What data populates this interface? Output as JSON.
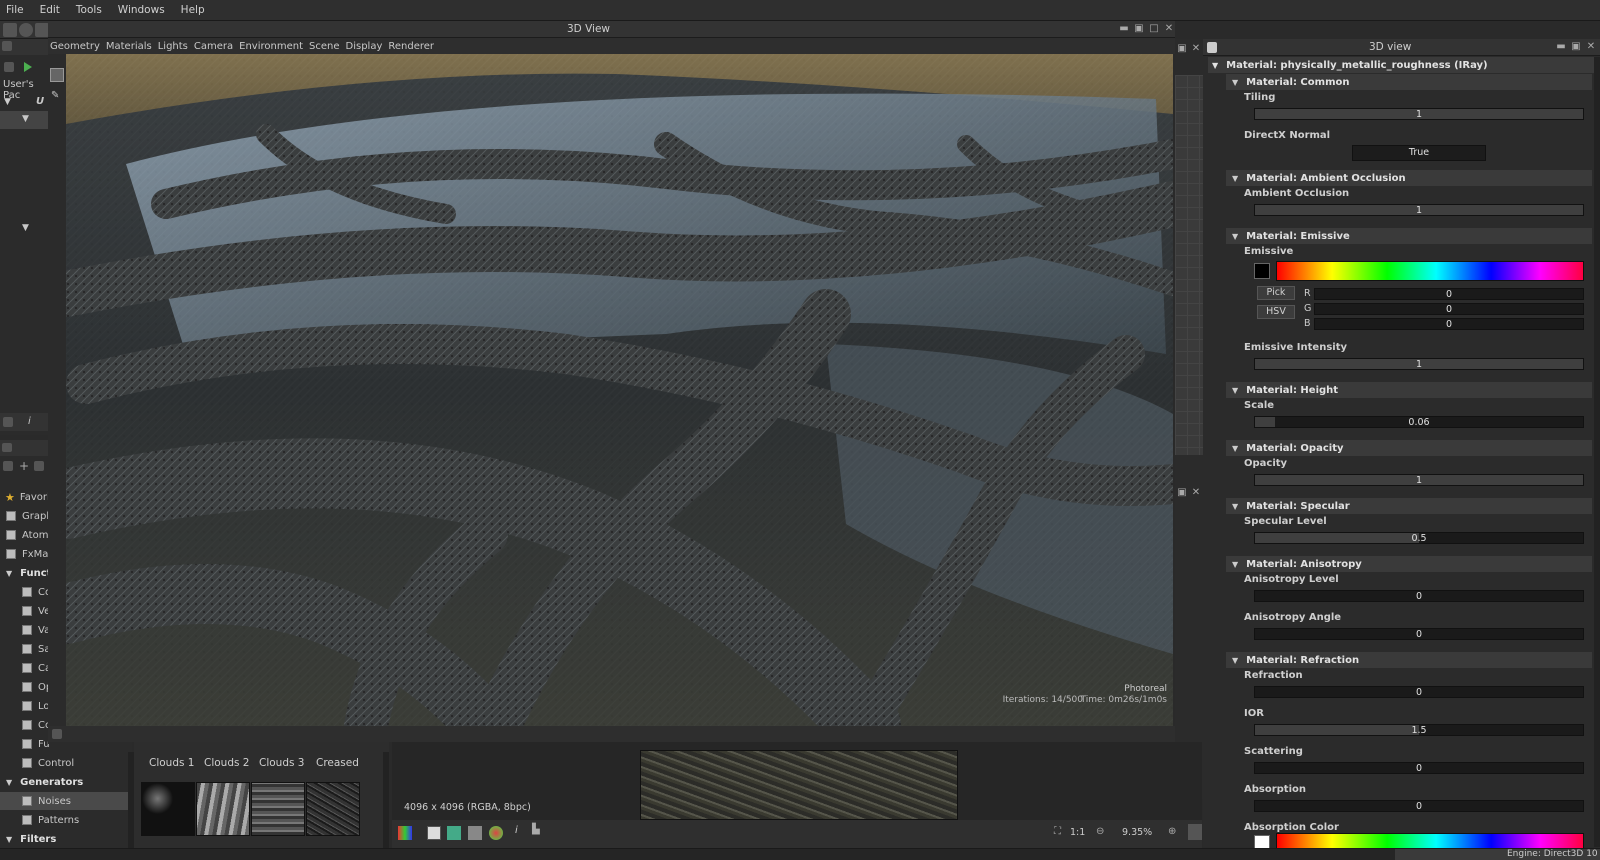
{
  "menu": [
    "File",
    "Edit",
    "Tools",
    "Windows",
    "Help"
  ],
  "view3d": {
    "title": "3D View",
    "menu": [
      "Geometry",
      "Materials",
      "Lights",
      "Camera",
      "Environment",
      "Scene",
      "Display",
      "Renderer"
    ],
    "overlay": {
      "mode": "Photoreal",
      "iterations": "Iterations: 14/500",
      "time": "Time: 0m26s/1m0s"
    }
  },
  "left_panel": {
    "explorer_label": "User's Pac",
    "explorer_root": "U",
    "library_items": [
      {
        "label": "Favori",
        "bold": false
      },
      {
        "label": "Graph",
        "bold": false
      },
      {
        "label": "Atom",
        "bold": false
      },
      {
        "label": "FxMap",
        "bold": false
      },
      {
        "label": "Funct",
        "bold": true
      },
      {
        "label": "Co",
        "bold": false
      },
      {
        "label": "Ve",
        "bold": false
      },
      {
        "label": "Va",
        "bold": false
      },
      {
        "label": "Sa",
        "bold": false
      },
      {
        "label": "Ca",
        "bold": false
      },
      {
        "label": "Op",
        "bold": false
      },
      {
        "label": "Lo",
        "bold": false
      },
      {
        "label": "Co",
        "bold": false
      },
      {
        "label": "Fu",
        "bold": false
      },
      {
        "label": "Control",
        "bold": false
      },
      {
        "label": "Generators",
        "bold": true
      },
      {
        "label": "Noises",
        "bold": false
      },
      {
        "label": "Patterns",
        "bold": false
      },
      {
        "label": "Filters",
        "bold": true
      }
    ]
  },
  "library_tabs": [
    "Clouds 1",
    "Clouds 2",
    "Clouds 3",
    "Creased"
  ],
  "view2d": {
    "resolution": "4096 x 4096 (RGBA, 8bpc)",
    "ratio": "1:1",
    "zoom": "9.35%"
  },
  "properties": {
    "title": "3D view",
    "material": "Material: physically_metallic_roughness (IRay)",
    "sections": [
      {
        "header": "Material: Common",
        "params": [
          {
            "label": "Tiling",
            "value": "1"
          },
          {
            "label": "DirectX Normal",
            "value": "True"
          }
        ]
      },
      {
        "header": "Material: Ambient Occlusion",
        "params": [
          {
            "label": "Ambient Occlusion",
            "value": "1"
          }
        ]
      },
      {
        "header": "Material: Emissive",
        "params": [
          {
            "label": "Emissive",
            "pick": "Pick",
            "hsv": "HSV",
            "r": "0",
            "g": "0",
            "b": "0",
            "rl": "R",
            "gl": "G",
            "bl": "B"
          },
          {
            "label": "Emissive Intensity",
            "value": "1"
          }
        ]
      },
      {
        "header": "Material: Height",
        "params": [
          {
            "label": "Scale",
            "value": "0.06",
            "fraction": 0.06
          }
        ]
      },
      {
        "header": "Material: Opacity",
        "params": [
          {
            "label": "Opacity",
            "value": "1"
          }
        ]
      },
      {
        "header": "Material: Specular",
        "params": [
          {
            "label": "Specular Level",
            "value": "0.5",
            "fraction": 0.5
          }
        ]
      },
      {
        "header": "Material: Anisotropy",
        "params": [
          {
            "label": "Anisotropy Level",
            "value": "0"
          },
          {
            "label": "Anisotropy Angle",
            "value": "0"
          }
        ]
      },
      {
        "header": "Material: Refraction",
        "params": [
          {
            "label": "Refraction",
            "value": "0"
          },
          {
            "label": "IOR",
            "value": "1.5",
            "fraction": 0.5
          },
          {
            "label": "Scattering",
            "value": "0"
          },
          {
            "label": "Absorption",
            "value": "0"
          },
          {
            "label": "Absorption Color"
          }
        ]
      }
    ]
  },
  "status": {
    "engine": "Engine: Direct3D 10"
  },
  "colors": {
    "emissive": "#000000",
    "absorption": "#ffffff"
  }
}
